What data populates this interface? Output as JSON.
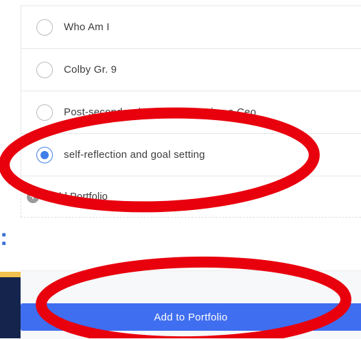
{
  "portfolio_options": [
    {
      "label": "Who Am I",
      "selected": false
    },
    {
      "label": "Colby Gr. 9",
      "selected": false
    },
    {
      "label": "Post-secondary/ road to becoming a Ceo",
      "selected": false
    },
    {
      "label": "self-reflection and goal setting",
      "selected": true
    }
  ],
  "add_portfolio": {
    "label": "Add Portfolio",
    "icon": "plus-circle-icon"
  },
  "footer": {
    "submit_label": "Add to Portfolio"
  },
  "colors": {
    "accent": "#3f7ee8",
    "button": "#3f6ef0",
    "annotation": "#e8000d"
  }
}
